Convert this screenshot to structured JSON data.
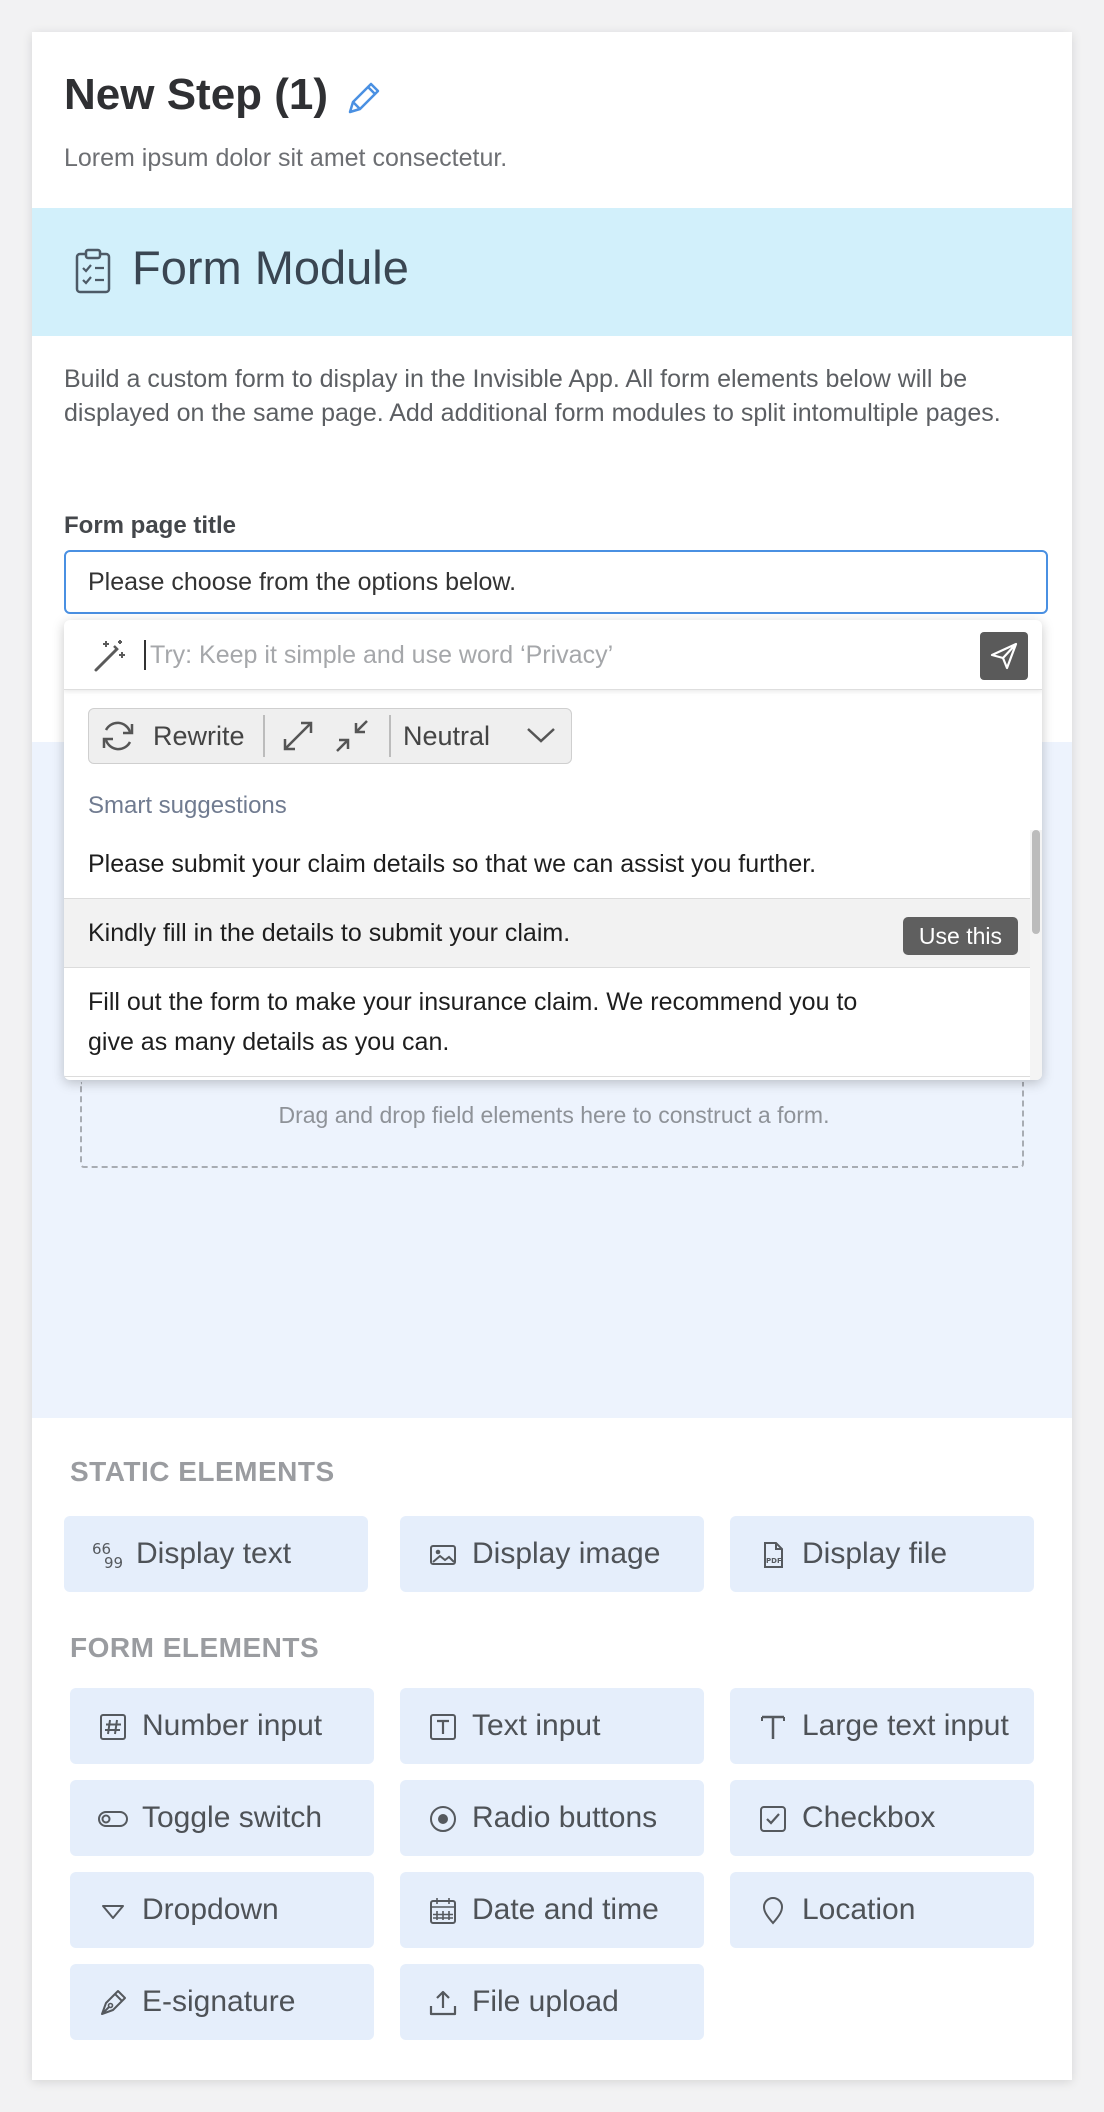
{
  "step": {
    "title": "New Step (1)",
    "subtitle": "Lorem ipsum dolor sit amet consectetur."
  },
  "module": {
    "title": "Form Module",
    "description": "Build a custom form to display in the Invisible App. All form elements below will be displayed on the same page. Add additional form modules to split intomultiple pages.",
    "page_title_label": "Form page title",
    "page_title_value": "Please choose from the options below."
  },
  "ai_assist": {
    "prompt_placeholder": "Try: Keep it simple and use word ‘Privacy’",
    "rewrite_label": "Rewrite",
    "tone_label": "Neutral",
    "suggestions_heading": "Smart suggestions",
    "suggestions": [
      {
        "text": "Please submit your claim details so that we can assist you further."
      },
      {
        "text": "Kindly fill in the details to submit your claim.",
        "action": "Use this"
      },
      {
        "text": "Fill out the form to make your insurance claim. We recommend you to give as many details as you can."
      }
    ]
  },
  "drop_zone": {
    "text": "Drag and drop field elements here to construct a form."
  },
  "static_elements": {
    "heading": "STATIC ELEMENTS",
    "items": [
      {
        "label": "Display text",
        "icon": "quote-icon"
      },
      {
        "label": "Display image",
        "icon": "image-icon"
      },
      {
        "label": "Display file",
        "icon": "pdf-file-icon"
      }
    ]
  },
  "form_elements": {
    "heading": "FORM ELEMENTS",
    "items": [
      {
        "label": "Number input",
        "icon": "hash-icon"
      },
      {
        "label": "Text input",
        "icon": "text-box-icon"
      },
      {
        "label": "Large text input",
        "icon": "text-t-icon"
      },
      {
        "label": "Toggle switch",
        "icon": "toggle-icon"
      },
      {
        "label": "Radio buttons",
        "icon": "radio-icon"
      },
      {
        "label": "Checkbox",
        "icon": "checkbox-icon"
      },
      {
        "label": "Dropdown",
        "icon": "triangle-down-icon"
      },
      {
        "label": "Date and time",
        "icon": "calendar-icon"
      },
      {
        "label": "Location",
        "icon": "location-pin-icon"
      },
      {
        "label": "E-signature",
        "icon": "pen-icon"
      },
      {
        "label": "File upload",
        "icon": "upload-icon"
      }
    ]
  },
  "colors": {
    "module_band": "#d2f0fb",
    "canvas": "#edf3fd",
    "tile": "#e5eefb",
    "accent": "#4a90e2"
  }
}
